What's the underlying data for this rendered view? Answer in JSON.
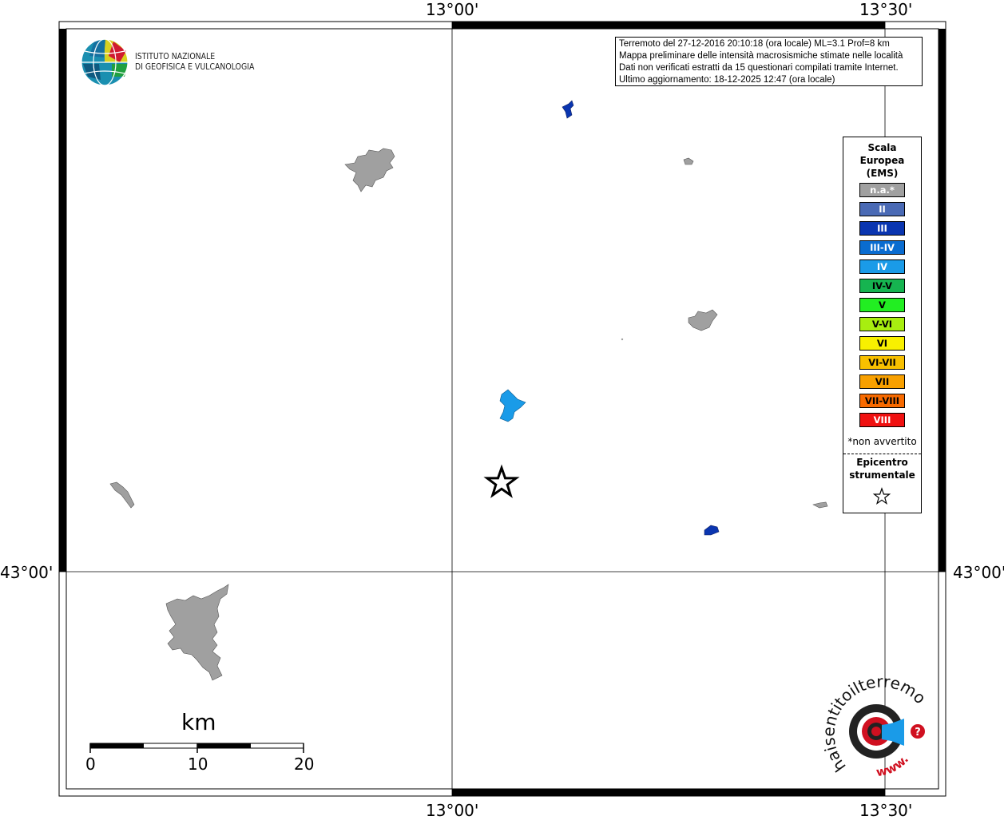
{
  "coords": {
    "lon_top_left": "13°00'",
    "lon_top_right": "13°30'",
    "lon_bottom_left": "13°00'",
    "lon_bottom_right": "13°30'",
    "lat_left": "43°00'",
    "lat_right": "43°00'"
  },
  "info": {
    "line1": "Terremoto del 27-12-2016 20:10:18 (ora locale) ML=3.1 Prof=8 km",
    "line2": "Mappa preliminare delle intensità macrosismiche stimate nelle località",
    "line3": "Dati non verificati estratti da 15 questionari compilati tramite Internet.",
    "line4": "Ultimo aggiornamento: 18-12-2025 12:47 (ora locale)"
  },
  "logo": {
    "line1": "ISTITUTO NAZIONALE",
    "line2": "DI GEOFISICA E VULCANOLOGIA"
  },
  "legend": {
    "title1": "Scala",
    "title2": "Europea",
    "title3": "(EMS)",
    "classes": [
      {
        "label": "n.a.*",
        "color": "#a0a0a0",
        "text": "#ffffff"
      },
      {
        "label": "II",
        "color": "#4a6ab5",
        "text": "#ffffff"
      },
      {
        "label": "III",
        "color": "#0a35b0",
        "text": "#ffffff"
      },
      {
        "label": "III-IV",
        "color": "#0a6cd0",
        "text": "#ffffff"
      },
      {
        "label": "IV",
        "color": "#1a9be8",
        "text": "#ffffff"
      },
      {
        "label": "IV-V",
        "color": "#16b450",
        "text": "#000000"
      },
      {
        "label": "V",
        "color": "#22ee22",
        "text": "#000000"
      },
      {
        "label": "V-VI",
        "color": "#a8ee10",
        "text": "#000000"
      },
      {
        "label": "VI",
        "color": "#f8f000",
        "text": "#000000"
      },
      {
        "label": "VI-VII",
        "color": "#f8c000",
        "text": "#000000"
      },
      {
        "label": "VII",
        "color": "#f8a000",
        "text": "#000000"
      },
      {
        "label": "VII-VIII",
        "color": "#f86a00",
        "text": "#000000"
      },
      {
        "label": "VIII",
        "color": "#f01010",
        "text": "#ffffff"
      }
    ],
    "note": "*non avvertito",
    "epi1": "Epicentro",
    "epi2": "strumentale"
  },
  "scale": {
    "unit": "km",
    "ticks": [
      "0",
      "10",
      "20"
    ]
  },
  "watermark": {
    "text": "haisentitoilterremoto.it",
    "www": "www."
  },
  "localities": [
    {
      "intensity": "n.a.*",
      "color": "#a0a0a0"
    },
    {
      "intensity": "n.a.*",
      "color": "#a0a0a0"
    },
    {
      "intensity": "n.a.*",
      "color": "#a0a0a0"
    },
    {
      "intensity": "n.a.*",
      "color": "#a0a0a0"
    },
    {
      "intensity": "n.a.*",
      "color": "#a0a0a0"
    },
    {
      "intensity": "n.a.*",
      "color": "#a0a0a0"
    },
    {
      "intensity": "III",
      "color": "#0a35b0"
    },
    {
      "intensity": "III",
      "color": "#0a35b0"
    },
    {
      "intensity": "IV",
      "color": "#1a9be8"
    }
  ]
}
